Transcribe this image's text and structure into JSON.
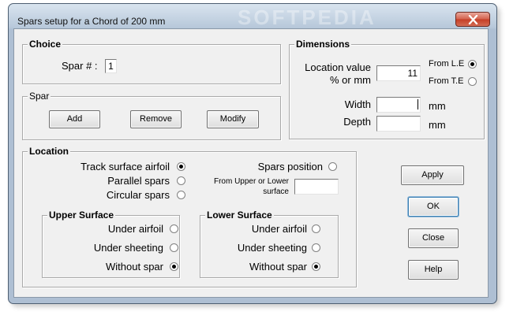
{
  "window": {
    "title": "Spars setup for a Chord of 200 mm",
    "watermark": "SOFTPEDIA",
    "close_glyph": "close-icon"
  },
  "choice": {
    "group_label": "Choice",
    "spar_label": "Spar # :",
    "spar_value": "1"
  },
  "spar": {
    "group_label": "Spar",
    "add": "Add",
    "remove": "Remove",
    "modify": "Modify"
  },
  "dimensions": {
    "group_label": "Dimensions",
    "location_value_label": "Location value",
    "percent_label": "% or mm",
    "location_value": "11",
    "from_le": "From L.E",
    "from_te": "From T.E",
    "width_label": "Width",
    "width_unit": "mm",
    "depth_label": "Depth",
    "depth_unit": "mm",
    "selected_reference": "From L.E"
  },
  "location": {
    "group_label": "Location",
    "options": [
      "Track surface airfoil",
      "Parallel spars",
      "Circular spars"
    ],
    "selected": "Track surface airfoil",
    "spars_position": "Spars position",
    "from_upper_lower_1": "From  Upper or  Lower",
    "from_upper_lower_2": "surface",
    "upper": {
      "group_label": "Upper Surface",
      "options": [
        "Under airfoil",
        "Under sheeting",
        "Without spar"
      ],
      "selected": "Without spar"
    },
    "lower": {
      "group_label": "Lower Surface",
      "options": [
        "Under airfoil",
        "Under sheeting",
        "Without spar"
      ],
      "selected": "Without spar"
    }
  },
  "actions": {
    "apply": "Apply",
    "ok": "OK",
    "close": "Close",
    "help": "Help"
  },
  "colors": {
    "dialog_bg": "#f0f0f0",
    "frame": "#aebfd3",
    "close_button": "#c43d25"
  }
}
